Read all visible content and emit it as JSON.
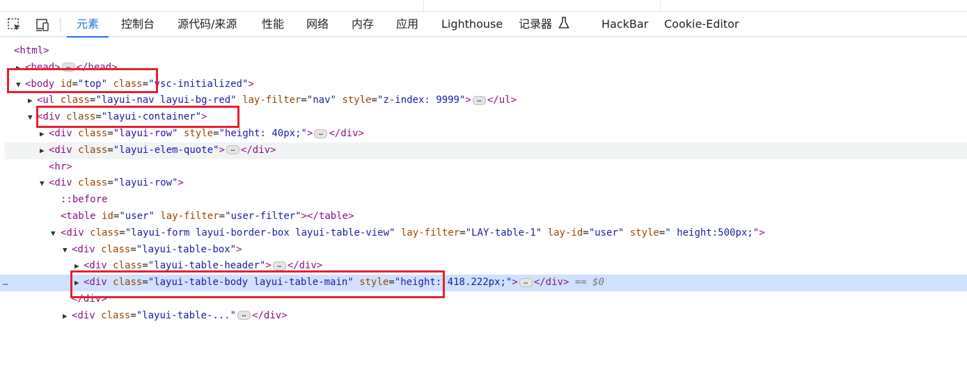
{
  "tabs": [
    {
      "label": "元素",
      "active": true
    },
    {
      "label": "控制台"
    },
    {
      "label": "源代码/来源"
    },
    {
      "label": "性能"
    },
    {
      "label": "网络"
    },
    {
      "label": "内存"
    },
    {
      "label": "应用"
    },
    {
      "label": "Lighthouse"
    },
    {
      "label": "记录器"
    },
    {
      "label": "HackBar"
    },
    {
      "label": "Cookie-Editor"
    }
  ],
  "icons": {
    "inspect": "select-element-icon",
    "device": "device-toolbar-icon",
    "recorder": "flask-icon"
  },
  "accent_color": "#1a73e8",
  "highlight_color": "#e5202e",
  "dom": {
    "l0_tag": "<html>",
    "l1": {
      "open": "<head>",
      "close": "</head>"
    },
    "l2": {
      "open": "<body",
      "a1": "id",
      "v1": "\"top\"",
      "a2": "class",
      "v2": "\"vsc-initialized\"",
      "end": ">"
    },
    "l3": {
      "open": "<ul",
      "a1": "class",
      "v1": "\"layui-nav layui-bg-red\"",
      "a2": "lay-filter",
      "v2": "\"nav\"",
      "a3": "style",
      "v3": "\"z-index: 9999\"",
      "end": ">",
      "close": "</ul>"
    },
    "l4": {
      "open": "<div",
      "a1": "class",
      "v1": "\"layui-container\"",
      "end": ">"
    },
    "l5": {
      "open": "<div",
      "a1": "class",
      "v1": "\"layui-row\"",
      "a2": "style",
      "v2": "\"height: 40px;\"",
      "end": ">",
      "close": "</div>"
    },
    "l6": {
      "open": "<div",
      "a1": "class",
      "v1": "\"layui-elem-quote\"",
      "end": ">",
      "close": "</div>"
    },
    "l7_tag": "<hr>",
    "l8": {
      "open": "<div",
      "a1": "class",
      "v1": "\"layui-row\"",
      "end": ">"
    },
    "l9_pseudo": "::before",
    "l10": {
      "open": "<table",
      "a1": "id",
      "v1": "\"user\"",
      "a2": "lay-filter",
      "v2": "\"user-filter\"",
      "end": "></table>"
    },
    "l11": {
      "open": "<div",
      "a1": "class",
      "v1": "\"layui-form layui-border-box layui-table-view\"",
      "a2": "lay-filter",
      "v2": "\"LAY-table-1\"",
      "a3": "lay-id",
      "v3": "\"user\"",
      "a4": "style",
      "v4": "\" height:500px;\"",
      "end": ">"
    },
    "l12": {
      "open": "<div",
      "a1": "class",
      "v1": "\"layui-table-box\"",
      "end": ">"
    },
    "l13": {
      "open": "<div",
      "a1": "class",
      "v1": "\"layui-table-header\"",
      "end": ">",
      "close": "</div>"
    },
    "l14": {
      "open": "<div",
      "a1": "class",
      "v1": "\"layui-table-body layui-table-main\"",
      "a2": "style",
      "v2": "\"height: 418.222px;\"",
      "end": ">",
      "close": "</div>",
      "eq": "== $0"
    },
    "l15_tag": "</div>",
    "l16": {
      "open": "<div",
      "a1": "class",
      "v1": "\"layui-table-...\"",
      "close": "</div>"
    },
    "ellipsis": "…",
    "row_menu": "…"
  }
}
